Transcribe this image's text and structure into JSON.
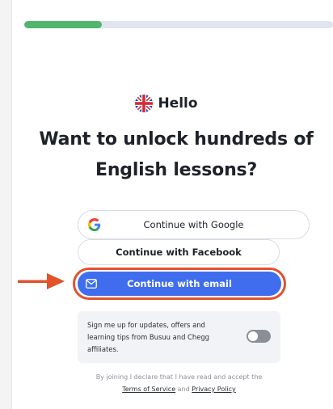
{
  "progress": {
    "fraction": 0.25,
    "color": "#52b56c"
  },
  "greeting": {
    "flag_icon": "uk-flag-icon",
    "text": "Hello"
  },
  "headline": {
    "line1": "Want to unlock hundreds of",
    "line2": "English lessons?"
  },
  "buttons": {
    "google": {
      "label": "Continue with Google",
      "icon": "google-g-icon"
    },
    "facebook": {
      "label": "Continue with Facebook"
    },
    "email": {
      "label": "Continue with email",
      "icon": "mail-icon",
      "color": "#3f6ded"
    }
  },
  "annotation": {
    "arrow_icon": "orange-arrow-icon",
    "highlight_color": "#e2522b"
  },
  "optin": {
    "line1": "Sign me up for updates, offers and",
    "line2": "learning tips from Busuu and Chegg",
    "line3": "affiliates.",
    "enabled": false
  },
  "legal": {
    "line1": "By joining I declare that I have read and accept the",
    "terms_link": "Terms of Service",
    "and": "and",
    "privacy_link": "Privacy Policy"
  }
}
